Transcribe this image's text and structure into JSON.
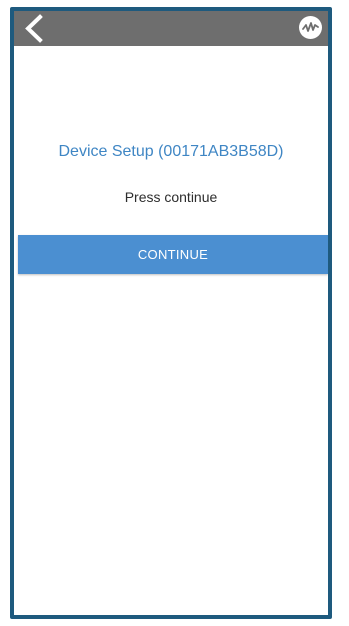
{
  "topbar": {
    "back_icon": "chevron-left-icon",
    "logo_icon": "waveform-logo-icon",
    "background": "#6e6e6e"
  },
  "main": {
    "title": "Device Setup (00171AB3B58D)",
    "instruction": "Press continue",
    "continue_label": "CONTINUE"
  },
  "colors": {
    "frame": "#1e5a7e",
    "title": "#3f86c4",
    "button": "#4b8fd1"
  }
}
